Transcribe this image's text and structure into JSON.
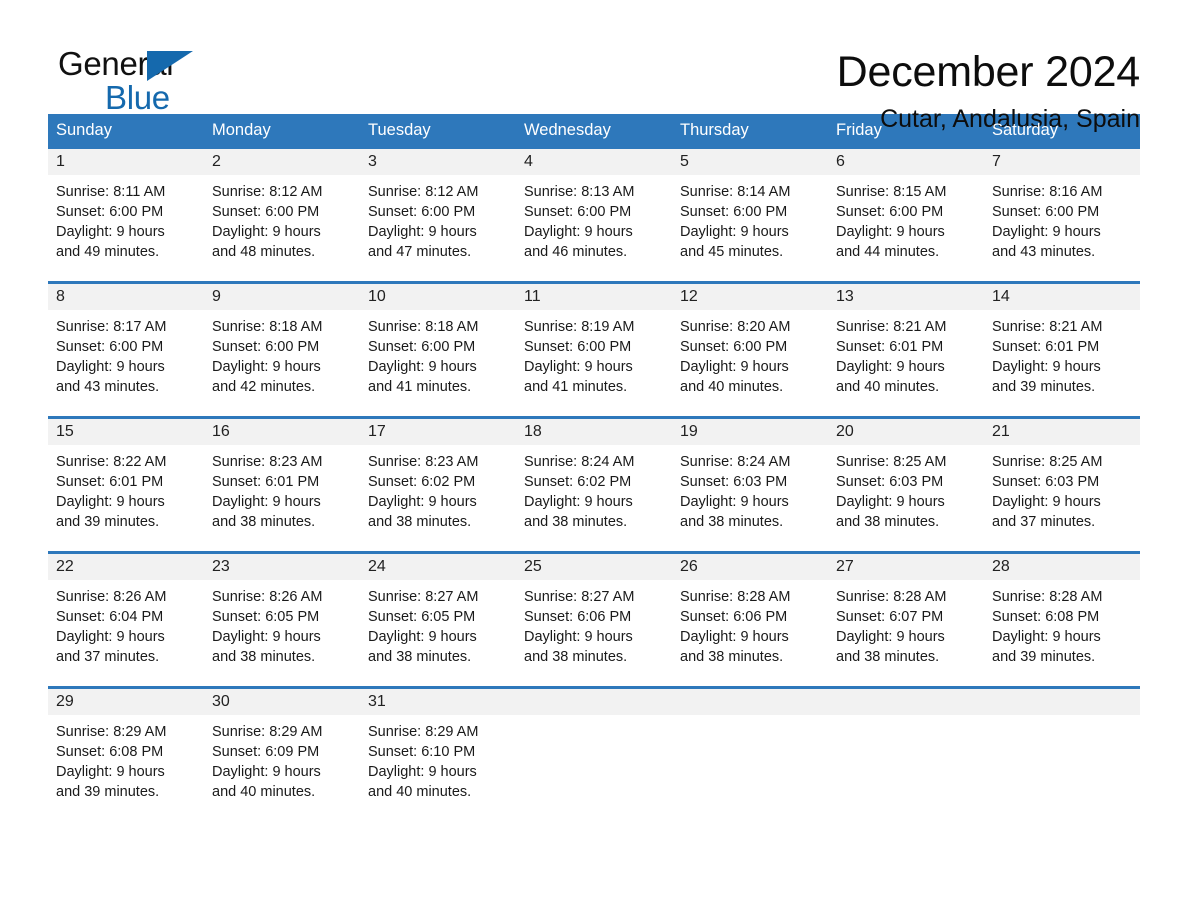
{
  "brand": {
    "word1": "General",
    "word2": "Blue",
    "triangle_color": "#1569ad",
    "logo_icon": "general-blue-triangle-icon"
  },
  "header": {
    "month_title": "December 2024",
    "location": "Cutar, Andalusia, Spain"
  },
  "theme": {
    "header_blue": "#2e78bb",
    "band_gray": "#f2f2f2",
    "text": "#1a1a1a"
  },
  "weekdays": [
    "Sunday",
    "Monday",
    "Tuesday",
    "Wednesday",
    "Thursday",
    "Friday",
    "Saturday"
  ],
  "labels": {
    "sunrise_prefix": "Sunrise:",
    "sunset_prefix": "Sunset:",
    "daylight_prefix": "Daylight:"
  },
  "weeks": [
    {
      "days": [
        {
          "date": "1",
          "sunrise": "Sunrise: 8:11 AM",
          "sunset": "Sunset: 6:00 PM",
          "daylight_line1": "Daylight: 9 hours",
          "daylight_line2": "and 49 minutes."
        },
        {
          "date": "2",
          "sunrise": "Sunrise: 8:12 AM",
          "sunset": "Sunset: 6:00 PM",
          "daylight_line1": "Daylight: 9 hours",
          "daylight_line2": "and 48 minutes."
        },
        {
          "date": "3",
          "sunrise": "Sunrise: 8:12 AM",
          "sunset": "Sunset: 6:00 PM",
          "daylight_line1": "Daylight: 9 hours",
          "daylight_line2": "and 47 minutes."
        },
        {
          "date": "4",
          "sunrise": "Sunrise: 8:13 AM",
          "sunset": "Sunset: 6:00 PM",
          "daylight_line1": "Daylight: 9 hours",
          "daylight_line2": "and 46 minutes."
        },
        {
          "date": "5",
          "sunrise": "Sunrise: 8:14 AM",
          "sunset": "Sunset: 6:00 PM",
          "daylight_line1": "Daylight: 9 hours",
          "daylight_line2": "and 45 minutes."
        },
        {
          "date": "6",
          "sunrise": "Sunrise: 8:15 AM",
          "sunset": "Sunset: 6:00 PM",
          "daylight_line1": "Daylight: 9 hours",
          "daylight_line2": "and 44 minutes."
        },
        {
          "date": "7",
          "sunrise": "Sunrise: 8:16 AM",
          "sunset": "Sunset: 6:00 PM",
          "daylight_line1": "Daylight: 9 hours",
          "daylight_line2": "and 43 minutes."
        }
      ]
    },
    {
      "days": [
        {
          "date": "8",
          "sunrise": "Sunrise: 8:17 AM",
          "sunset": "Sunset: 6:00 PM",
          "daylight_line1": "Daylight: 9 hours",
          "daylight_line2": "and 43 minutes."
        },
        {
          "date": "9",
          "sunrise": "Sunrise: 8:18 AM",
          "sunset": "Sunset: 6:00 PM",
          "daylight_line1": "Daylight: 9 hours",
          "daylight_line2": "and 42 minutes."
        },
        {
          "date": "10",
          "sunrise": "Sunrise: 8:18 AM",
          "sunset": "Sunset: 6:00 PM",
          "daylight_line1": "Daylight: 9 hours",
          "daylight_line2": "and 41 minutes."
        },
        {
          "date": "11",
          "sunrise": "Sunrise: 8:19 AM",
          "sunset": "Sunset: 6:00 PM",
          "daylight_line1": "Daylight: 9 hours",
          "daylight_line2": "and 41 minutes."
        },
        {
          "date": "12",
          "sunrise": "Sunrise: 8:20 AM",
          "sunset": "Sunset: 6:00 PM",
          "daylight_line1": "Daylight: 9 hours",
          "daylight_line2": "and 40 minutes."
        },
        {
          "date": "13",
          "sunrise": "Sunrise: 8:21 AM",
          "sunset": "Sunset: 6:01 PM",
          "daylight_line1": "Daylight: 9 hours",
          "daylight_line2": "and 40 minutes."
        },
        {
          "date": "14",
          "sunrise": "Sunrise: 8:21 AM",
          "sunset": "Sunset: 6:01 PM",
          "daylight_line1": "Daylight: 9 hours",
          "daylight_line2": "and 39 minutes."
        }
      ]
    },
    {
      "days": [
        {
          "date": "15",
          "sunrise": "Sunrise: 8:22 AM",
          "sunset": "Sunset: 6:01 PM",
          "daylight_line1": "Daylight: 9 hours",
          "daylight_line2": "and 39 minutes."
        },
        {
          "date": "16",
          "sunrise": "Sunrise: 8:23 AM",
          "sunset": "Sunset: 6:01 PM",
          "daylight_line1": "Daylight: 9 hours",
          "daylight_line2": "and 38 minutes."
        },
        {
          "date": "17",
          "sunrise": "Sunrise: 8:23 AM",
          "sunset": "Sunset: 6:02 PM",
          "daylight_line1": "Daylight: 9 hours",
          "daylight_line2": "and 38 minutes."
        },
        {
          "date": "18",
          "sunrise": "Sunrise: 8:24 AM",
          "sunset": "Sunset: 6:02 PM",
          "daylight_line1": "Daylight: 9 hours",
          "daylight_line2": "and 38 minutes."
        },
        {
          "date": "19",
          "sunrise": "Sunrise: 8:24 AM",
          "sunset": "Sunset: 6:03 PM",
          "daylight_line1": "Daylight: 9 hours",
          "daylight_line2": "and 38 minutes."
        },
        {
          "date": "20",
          "sunrise": "Sunrise: 8:25 AM",
          "sunset": "Sunset: 6:03 PM",
          "daylight_line1": "Daylight: 9 hours",
          "daylight_line2": "and 38 minutes."
        },
        {
          "date": "21",
          "sunrise": "Sunrise: 8:25 AM",
          "sunset": "Sunset: 6:03 PM",
          "daylight_line1": "Daylight: 9 hours",
          "daylight_line2": "and 37 minutes."
        }
      ]
    },
    {
      "days": [
        {
          "date": "22",
          "sunrise": "Sunrise: 8:26 AM",
          "sunset": "Sunset: 6:04 PM",
          "daylight_line1": "Daylight: 9 hours",
          "daylight_line2": "and 37 minutes."
        },
        {
          "date": "23",
          "sunrise": "Sunrise: 8:26 AM",
          "sunset": "Sunset: 6:05 PM",
          "daylight_line1": "Daylight: 9 hours",
          "daylight_line2": "and 38 minutes."
        },
        {
          "date": "24",
          "sunrise": "Sunrise: 8:27 AM",
          "sunset": "Sunset: 6:05 PM",
          "daylight_line1": "Daylight: 9 hours",
          "daylight_line2": "and 38 minutes."
        },
        {
          "date": "25",
          "sunrise": "Sunrise: 8:27 AM",
          "sunset": "Sunset: 6:06 PM",
          "daylight_line1": "Daylight: 9 hours",
          "daylight_line2": "and 38 minutes."
        },
        {
          "date": "26",
          "sunrise": "Sunrise: 8:28 AM",
          "sunset": "Sunset: 6:06 PM",
          "daylight_line1": "Daylight: 9 hours",
          "daylight_line2": "and 38 minutes."
        },
        {
          "date": "27",
          "sunrise": "Sunrise: 8:28 AM",
          "sunset": "Sunset: 6:07 PM",
          "daylight_line1": "Daylight: 9 hours",
          "daylight_line2": "and 38 minutes."
        },
        {
          "date": "28",
          "sunrise": "Sunrise: 8:28 AM",
          "sunset": "Sunset: 6:08 PM",
          "daylight_line1": "Daylight: 9 hours",
          "daylight_line2": "and 39 minutes."
        }
      ]
    },
    {
      "days": [
        {
          "date": "29",
          "sunrise": "Sunrise: 8:29 AM",
          "sunset": "Sunset: 6:08 PM",
          "daylight_line1": "Daylight: 9 hours",
          "daylight_line2": "and 39 minutes."
        },
        {
          "date": "30",
          "sunrise": "Sunrise: 8:29 AM",
          "sunset": "Sunset: 6:09 PM",
          "daylight_line1": "Daylight: 9 hours",
          "daylight_line2": "and 40 minutes."
        },
        {
          "date": "31",
          "sunrise": "Sunrise: 8:29 AM",
          "sunset": "Sunset: 6:10 PM",
          "daylight_line1": "Daylight: 9 hours",
          "daylight_line2": "and 40 minutes."
        },
        {
          "date": "",
          "sunrise": "",
          "sunset": "",
          "daylight_line1": "",
          "daylight_line2": ""
        },
        {
          "date": "",
          "sunrise": "",
          "sunset": "",
          "daylight_line1": "",
          "daylight_line2": ""
        },
        {
          "date": "",
          "sunrise": "",
          "sunset": "",
          "daylight_line1": "",
          "daylight_line2": ""
        },
        {
          "date": "",
          "sunrise": "",
          "sunset": "",
          "daylight_line1": "",
          "daylight_line2": ""
        }
      ]
    }
  ]
}
